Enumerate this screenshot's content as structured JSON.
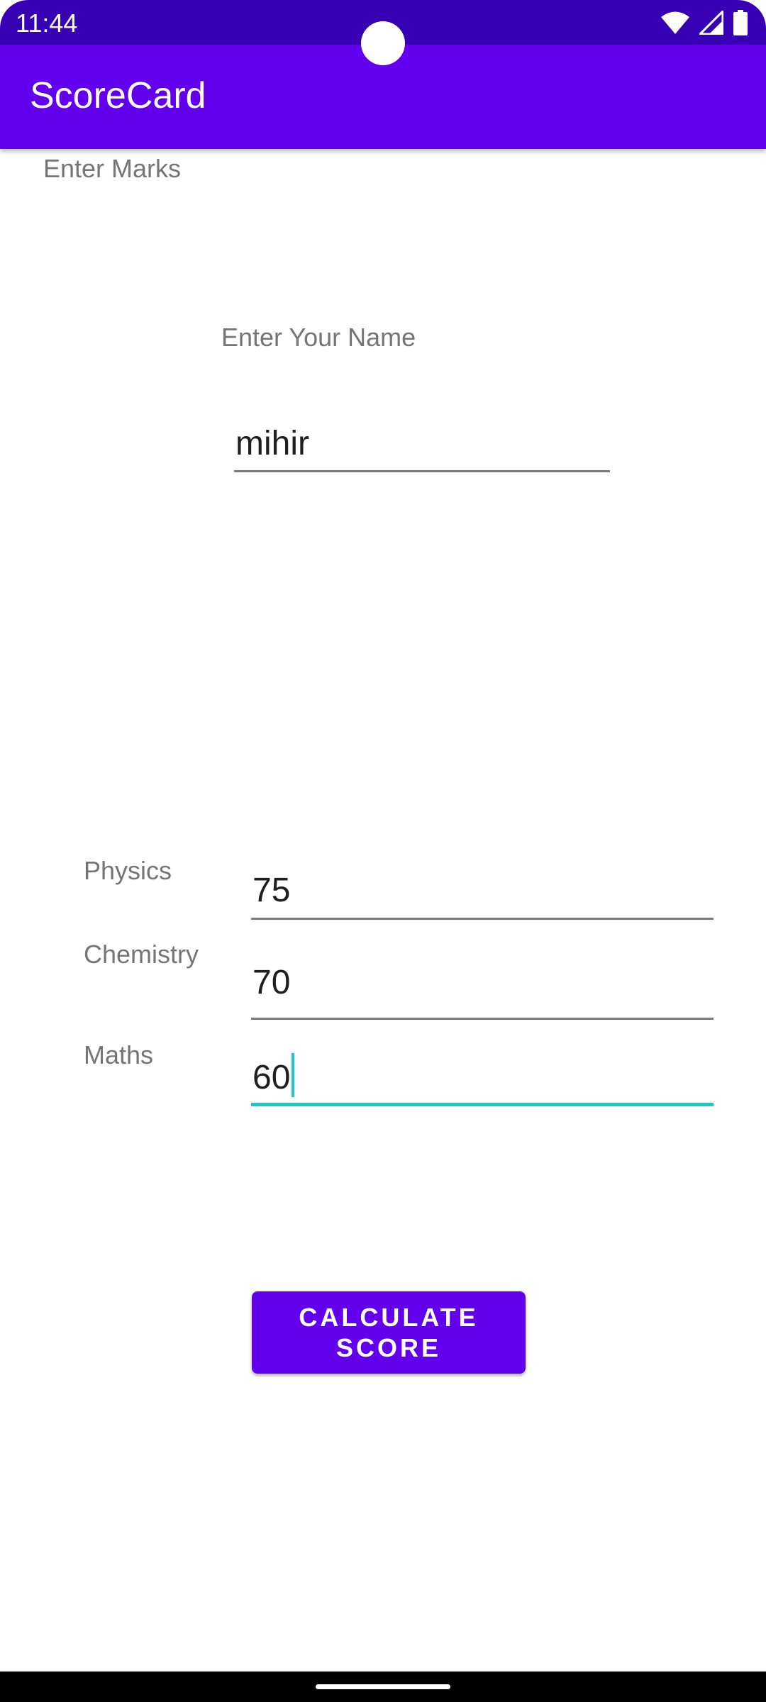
{
  "status_bar": {
    "time": "11:44",
    "icons": [
      "wifi-icon",
      "signal-icon",
      "battery-icon"
    ]
  },
  "app_bar": {
    "title": "ScoreCard"
  },
  "section_label": "Enter Marks",
  "name_section": {
    "label": "Enter Your Name",
    "value": "mihir"
  },
  "subjects": [
    {
      "label": "Physics",
      "value": "75"
    },
    {
      "label": "Chemistry",
      "value": "70"
    },
    {
      "label": "Maths",
      "value": "60"
    }
  ],
  "calculate_button": {
    "label": "CALCULATE SCORE"
  },
  "colors": {
    "status_bar": "#3700b3",
    "app_bar": "#6200ee",
    "button": "#6200ee",
    "focus_accent": "#1fc8c0"
  }
}
